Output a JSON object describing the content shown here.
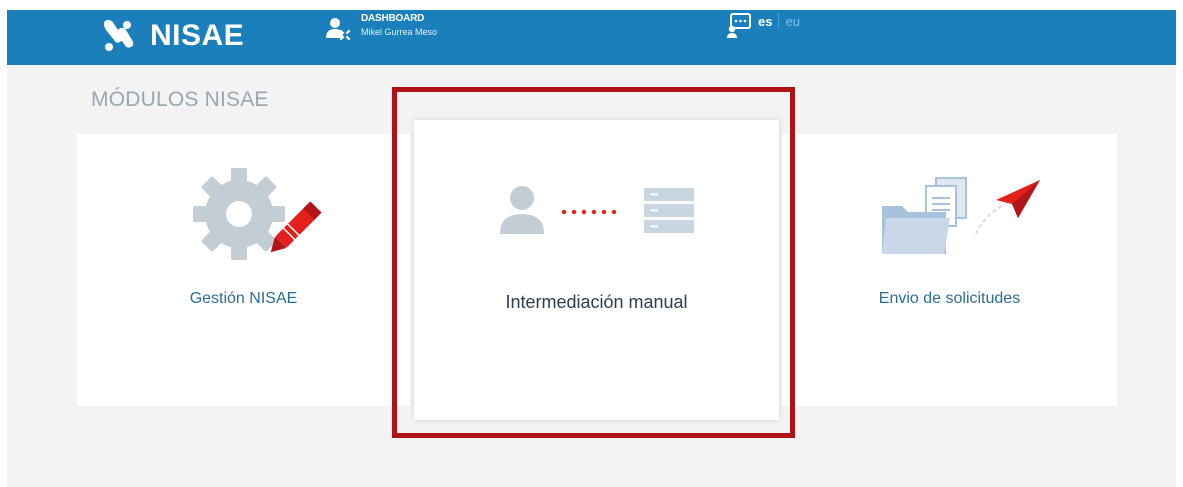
{
  "header": {
    "app_name": "NISAE",
    "dashboard_label": "DASHBOARD",
    "user_name": "Mikel Gurrea Meso",
    "languages": [
      "es",
      "eu"
    ],
    "active_language": "es"
  },
  "main": {
    "section_title": "MÓDULOS NISAE",
    "modules": [
      {
        "label": "Gestión NISAE",
        "icon": "gear-pencil-icon"
      },
      {
        "label": "Intermediación manual",
        "icon": "user-server-connection-icon"
      },
      {
        "label": "Envio de solicitudes",
        "icon": "folder-send-icon"
      }
    ]
  },
  "colors": {
    "header_bg": "#1b7fbc",
    "highlight_border": "#b01218",
    "accent_red": "#e3201b",
    "icon_gray": "#c3cdd5",
    "icon_blue": "#a7c3dc"
  }
}
